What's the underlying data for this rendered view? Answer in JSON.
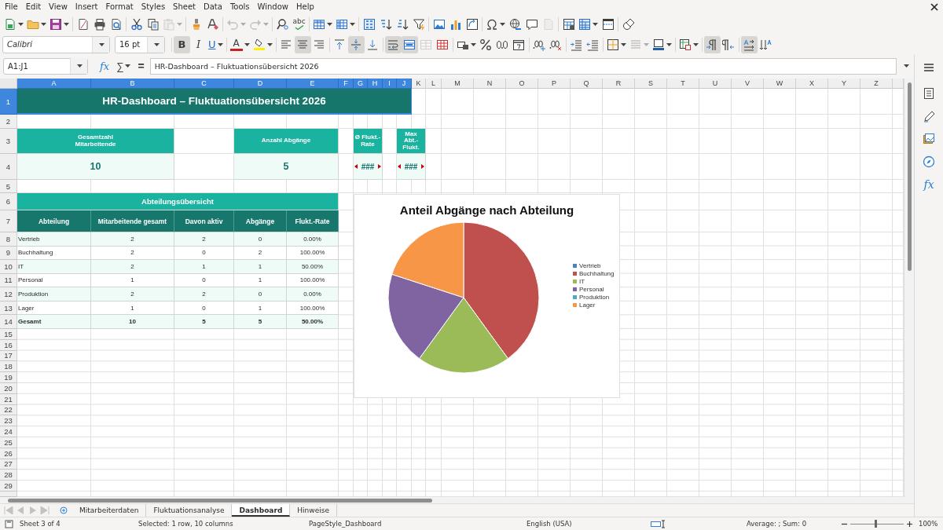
{
  "menubar": {
    "items": [
      "File",
      "Edit",
      "View",
      "Insert",
      "Format",
      "Styles",
      "Sheet",
      "Data",
      "Tools",
      "Window",
      "Help"
    ]
  },
  "standard_toolbar": [
    [
      {
        "kind": "new",
        "dropdown": true,
        "disabled": false
      },
      {
        "kind": "open",
        "dropdown": true,
        "disabled": false
      },
      {
        "kind": "save",
        "dropdown": true,
        "disabled": false
      }
    ],
    [
      {
        "kind": "pdf",
        "dropdown": false,
        "disabled": false
      },
      {
        "kind": "print",
        "dropdown": false,
        "disabled": false
      },
      {
        "kind": "preview",
        "dropdown": false,
        "disabled": false
      }
    ],
    [
      {
        "kind": "cut",
        "dropdown": false,
        "disabled": false
      },
      {
        "kind": "copy",
        "dropdown": false,
        "disabled": false
      },
      {
        "kind": "paste",
        "dropdown": true,
        "disabled": true
      }
    ],
    [
      {
        "kind": "clone",
        "dropdown": false,
        "disabled": false
      },
      {
        "kind": "clear",
        "dropdown": false,
        "disabled": false
      }
    ],
    [
      {
        "kind": "undo",
        "dropdown": true,
        "disabled": true
      },
      {
        "kind": "redo",
        "dropdown": true,
        "disabled": true
      }
    ],
    [
      {
        "kind": "find",
        "dropdown": false,
        "disabled": false
      },
      {
        "kind": "spelling",
        "label": "abc",
        "dropdown": false,
        "disabled": false
      }
    ],
    [
      {
        "kind": "row",
        "dropdown": true,
        "disabled": false
      },
      {
        "kind": "column",
        "dropdown": true,
        "disabled": false
      }
    ],
    [
      {
        "kind": "sort",
        "dropdown": false,
        "disabled": false
      },
      {
        "kind": "sort_asc",
        "dropdown": false,
        "disabled": false
      },
      {
        "kind": "sort_desc",
        "dropdown": false,
        "disabled": false
      },
      {
        "kind": "filter",
        "dropdown": false,
        "disabled": false
      }
    ],
    [
      {
        "kind": "image",
        "dropdown": false,
        "disabled": false
      },
      {
        "kind": "chart",
        "dropdown": false,
        "disabled": false
      },
      {
        "kind": "pivot",
        "dropdown": false,
        "disabled": false
      }
    ],
    [
      {
        "kind": "special",
        "dropdown": true,
        "disabled": false
      },
      {
        "kind": "link",
        "dropdown": false,
        "disabled": false
      },
      {
        "kind": "comment",
        "dropdown": false,
        "disabled": false
      },
      {
        "kind": "headerfooter",
        "dropdown": false,
        "disabled": true
      }
    ],
    [
      {
        "kind": "print_area",
        "dropdown": false,
        "disabled": false
      },
      {
        "kind": "freeze",
        "dropdown": true,
        "disabled": false
      },
      {
        "kind": "split",
        "dropdown": false,
        "disabled": false
      }
    ],
    [
      {
        "kind": "shapes",
        "dropdown": false,
        "disabled": false
      }
    ]
  ],
  "formatting_toolbar": {
    "font_name": "Calibri",
    "font_size": "16 pt",
    "groups": [
      [
        {
          "kind": "bold",
          "label": "B",
          "dropdown": false,
          "selected": true,
          "disabled": false
        },
        {
          "kind": "italic",
          "label": "I",
          "dropdown": false,
          "selected": false,
          "disabled": false
        },
        {
          "kind": "underline",
          "label": "U",
          "dropdown": true,
          "selected": false,
          "disabled": false
        }
      ],
      [
        {
          "kind": "font_color",
          "label": "A",
          "dropdown": true,
          "selected": false,
          "disabled": false
        },
        {
          "kind": "highlight",
          "dropdown": true,
          "selected": false,
          "disabled": false
        }
      ],
      [
        {
          "kind": "align_left",
          "dropdown": false,
          "selected": false,
          "disabled": false
        },
        {
          "kind": "align_center",
          "dropdown": false,
          "selected": true,
          "disabled": false
        },
        {
          "kind": "align_right",
          "dropdown": false,
          "selected": false,
          "disabled": false
        }
      ],
      [
        {
          "kind": "align_top",
          "dropdown": false,
          "selected": false,
          "disabled": false
        },
        {
          "kind": "align_middle",
          "dropdown": false,
          "selected": true,
          "disabled": false
        },
        {
          "kind": "align_bottom",
          "dropdown": false,
          "selected": false,
          "disabled": false
        }
      ],
      [
        {
          "kind": "wrap",
          "dropdown": false,
          "selected": true,
          "disabled": false
        },
        {
          "kind": "merge_center",
          "dropdown": false,
          "selected": true,
          "disabled": false
        },
        {
          "kind": "merge",
          "dropdown": false,
          "selected": false,
          "disabled": true
        },
        {
          "kind": "unmerge",
          "dropdown": false,
          "selected": false,
          "disabled": false
        }
      ],
      [
        {
          "kind": "currency",
          "dropdown": true,
          "selected": false,
          "disabled": false
        },
        {
          "kind": "percent",
          "dropdown": false,
          "selected": false,
          "disabled": false
        },
        {
          "kind": "number",
          "dropdown": false,
          "selected": false,
          "disabled": false
        },
        {
          "kind": "date",
          "dropdown": false,
          "selected": false,
          "disabled": false
        }
      ],
      [
        {
          "kind": "add_decimal",
          "dropdown": false,
          "selected": false,
          "disabled": false
        },
        {
          "kind": "del_decimal",
          "dropdown": false,
          "selected": false,
          "disabled": false
        }
      ],
      [
        {
          "kind": "indent_inc",
          "dropdown": false,
          "selected": false,
          "disabled": false
        },
        {
          "kind": "indent_dec",
          "dropdown": false,
          "selected": false,
          "disabled": false
        }
      ],
      [
        {
          "kind": "borders",
          "dropdown": true,
          "selected": false,
          "disabled": false
        },
        {
          "kind": "border_style",
          "dropdown": true,
          "selected": false,
          "disabled": true
        },
        {
          "kind": "border_color",
          "dropdown": true,
          "selected": false,
          "disabled": false
        }
      ],
      [
        {
          "kind": "conditional",
          "dropdown": true,
          "selected": false,
          "disabled": false
        }
      ],
      [
        {
          "kind": "ltr",
          "dropdown": false,
          "selected": true,
          "disabled": false
        },
        {
          "kind": "rtl",
          "dropdown": false,
          "selected": false,
          "disabled": false
        }
      ],
      [
        {
          "kind": "text_ltr",
          "dropdown": false,
          "selected": true,
          "disabled": false
        },
        {
          "kind": "text_vertical",
          "dropdown": false,
          "selected": false,
          "disabled": false
        }
      ]
    ]
  },
  "formula_bar": {
    "name_box": "A1:J1",
    "wizard_label": "fx",
    "sum_label": "∑",
    "equals_label": "=",
    "formula": "HR-Dashboard – Fluktuationsübersicht 2026"
  },
  "sidebar": {
    "items": [
      {
        "kind": "properties"
      },
      {
        "kind": "styles"
      },
      {
        "kind": "gallery"
      },
      {
        "kind": "navigator"
      },
      {
        "kind": "functions",
        "label": "fx"
      }
    ]
  },
  "sheet": {
    "columns": [
      {
        "label": "A",
        "selected": true
      },
      {
        "label": "B",
        "selected": true
      },
      {
        "label": "C",
        "selected": true
      },
      {
        "label": "D",
        "selected": true
      },
      {
        "label": "E",
        "selected": true
      },
      {
        "label": "F",
        "selected": true
      },
      {
        "label": "G",
        "selected": true
      },
      {
        "label": "H",
        "selected": true
      },
      {
        "label": "I",
        "selected": true
      },
      {
        "label": "J",
        "selected": true
      },
      {
        "label": "K",
        "selected": false
      },
      {
        "label": "L",
        "selected": false
      },
      {
        "label": "M",
        "selected": false
      },
      {
        "label": "N",
        "selected": false
      },
      {
        "label": "O",
        "selected": false
      },
      {
        "label": "P",
        "selected": false
      },
      {
        "label": "Q",
        "selected": false
      },
      {
        "label": "R",
        "selected": false
      },
      {
        "label": "S",
        "selected": false
      },
      {
        "label": "T",
        "selected": false
      },
      {
        "label": "U",
        "selected": false
      },
      {
        "label": "V",
        "selected": false
      },
      {
        "label": "W",
        "selected": false
      },
      {
        "label": "X",
        "selected": false
      },
      {
        "label": "Y",
        "selected": false
      },
      {
        "label": "Z",
        "selected": false
      }
    ],
    "rows": [
      {
        "label": "1",
        "selected": true
      },
      {
        "label": "2",
        "selected": false
      },
      {
        "label": "3",
        "selected": false
      },
      {
        "label": "4",
        "selected": false
      },
      {
        "label": "5",
        "selected": false
      },
      {
        "label": "6",
        "selected": false
      },
      {
        "label": "7",
        "selected": false
      },
      {
        "label": "8",
        "selected": false
      },
      {
        "label": "9",
        "selected": false
      },
      {
        "label": "10",
        "selected": false
      },
      {
        "label": "11",
        "selected": false
      },
      {
        "label": "12",
        "selected": false
      },
      {
        "label": "13",
        "selected": false
      },
      {
        "label": "14",
        "selected": false
      },
      {
        "label": "15",
        "selected": false
      },
      {
        "label": "16",
        "selected": false
      },
      {
        "label": "17",
        "selected": false
      },
      {
        "label": "18",
        "selected": false
      },
      {
        "label": "19",
        "selected": false
      },
      {
        "label": "20",
        "selected": false
      },
      {
        "label": "21",
        "selected": false
      },
      {
        "label": "22",
        "selected": false
      },
      {
        "label": "23",
        "selected": false
      },
      {
        "label": "24",
        "selected": false
      },
      {
        "label": "25",
        "selected": false
      },
      {
        "label": "26",
        "selected": false
      },
      {
        "label": "27",
        "selected": false
      },
      {
        "label": "28",
        "selected": false
      },
      {
        "label": "29",
        "selected": false
      }
    ],
    "title": "HR-Dashboard – Fluktuationsübersicht 2026",
    "kpis": [
      {
        "label": "Gesamtzahl\nMitarbeitende",
        "value": "10",
        "clipped": false
      },
      {
        "label": "Anzahl Abgänge",
        "value": "5",
        "clipped": false
      },
      {
        "label": "Ø Flukt.-Rate",
        "value": "###",
        "clipped": true
      },
      {
        "label": "Max Abt.-Flukt.",
        "value": "###",
        "clipped": true
      }
    ],
    "section_title": "Abteilungsübersicht",
    "table": {
      "columns": [
        "Abteilung",
        "Mitarbeitende gesamt",
        "Davon aktiv",
        "Abgänge",
        "Flukt.-Rate"
      ],
      "rows": [
        {
          "kind": "department",
          "cells": [
            "Vertrieb",
            "2",
            "2",
            "0",
            "0.00%"
          ]
        },
        {
          "kind": "department",
          "cells": [
            "Buchhaltung",
            "2",
            "0",
            "2",
            "100.00%"
          ]
        },
        {
          "kind": "department",
          "cells": [
            "IT",
            "2",
            "1",
            "1",
            "50.00%"
          ]
        },
        {
          "kind": "department",
          "cells": [
            "Personal",
            "1",
            "0",
            "1",
            "100.00%"
          ]
        },
        {
          "kind": "department",
          "cells": [
            "Produktion",
            "2",
            "2",
            "0",
            "0.00%"
          ]
        },
        {
          "kind": "department",
          "cells": [
            "Lager",
            "1",
            "0",
            "1",
            "100.00%"
          ]
        },
        {
          "kind": "total",
          "cells": [
            "Gesamt",
            "10",
            "5",
            "5",
            "50.00%"
          ]
        }
      ]
    },
    "chart": {
      "chart_data": {
        "type": "pie",
        "title": "Anteil Abgänge nach Abteilung",
        "categories": [
          "Vertrieb",
          "Buchhaltung",
          "IT",
          "Personal",
          "Produktion",
          "Lager"
        ],
        "series": [
          {
            "values": [
              0,
              40,
              20,
              20,
              0,
              20
            ]
          }
        ],
        "legend": "right",
        "colors": [
          "#4f81bd",
          "#c0504d",
          "#9bbb59",
          "#8064a2",
          "#4bacc6",
          "#f79646"
        ]
      }
    }
  },
  "sheet_navigation": {
    "disabled": true
  },
  "sheet_tabs": [
    {
      "label": "Mitarbeiterdaten",
      "selected": false
    },
    {
      "label": "Fluktuationsanalyse",
      "selected": false
    },
    {
      "label": "Dashboard",
      "selected": true
    },
    {
      "label": "Hinweise",
      "selected": false
    }
  ],
  "status_bar": {
    "sheet": "Sheet 3 of 4",
    "selection": "Selected: 1 row, 10 columns",
    "page_style": "PageStyle_Dashboard",
    "language": "English (USA)",
    "summary": "Average: ; Sum: 0",
    "zoom": {
      "level": 0.47
    },
    "zoom_label": "100%"
  }
}
